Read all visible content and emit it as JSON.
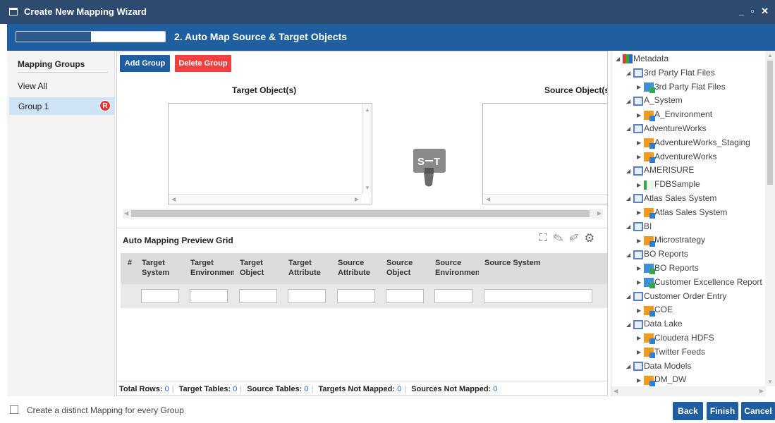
{
  "window": {
    "title": "Create New Mapping Wizard",
    "controls": "_ ▫ ✕"
  },
  "step": {
    "title": "2. Auto Map Source & Target Objects",
    "progress": 0.5
  },
  "sidebar": {
    "title": "Mapping Groups",
    "view_all": "View All",
    "groups": [
      {
        "label": "Group 1",
        "badge": "R"
      }
    ]
  },
  "toolbar": {
    "add_group": "Add Group",
    "delete_group": "Delete Group"
  },
  "objects": {
    "target_label": "Target Object(s)",
    "source_label": "Source Object(s"
  },
  "grid": {
    "title": "Auto Mapping Preview Grid",
    "columns": [
      "#",
      "Target System",
      "Target Environment",
      "Target Object",
      "Target Attribute",
      "Source Attribute",
      "Source Object",
      "Source Environment",
      "Source System"
    ],
    "footer": {
      "total_rows_label": "Total Rows:",
      "total_rows": "0",
      "target_tables_label": "Target Tables:",
      "target_tables": "0",
      "source_tables_label": "Source Tables:",
      "source_tables": "0",
      "targets_not_mapped_label": "Targets Not Mapped:",
      "targets_not_mapped": "0",
      "sources_not_mapped_label": "Sources Not Mapped:",
      "sources_not_mapped": "0"
    }
  },
  "tree": [
    {
      "label": "Metadata",
      "icon": "metadata-icon",
      "level": 0,
      "expanded": true
    },
    {
      "label": "3rd Party Flat Files",
      "icon": "system-icon",
      "level": 1,
      "expanded": true
    },
    {
      "label": "3rd Party Flat Files",
      "icon": "flat-file-icon",
      "level": 2,
      "expanded": false
    },
    {
      "label": "A_System",
      "icon": "system-icon",
      "level": 1,
      "expanded": true
    },
    {
      "label": "A_Environment",
      "icon": "environment-icon",
      "level": 2,
      "expanded": false
    },
    {
      "label": "AdventureWorks",
      "icon": "system-icon",
      "level": 1,
      "expanded": true
    },
    {
      "label": "AdventureWorks_Staging",
      "icon": "environment-icon",
      "level": 2,
      "expanded": false
    },
    {
      "label": "AdventureWorks",
      "icon": "environment-icon",
      "level": 2,
      "expanded": false
    },
    {
      "label": "AMERISURE",
      "icon": "system-icon",
      "level": 1,
      "expanded": true
    },
    {
      "label": "FDBSample",
      "icon": "excel-icon",
      "level": 2,
      "expanded": false
    },
    {
      "label": "Atlas Sales System",
      "icon": "system-icon",
      "level": 1,
      "expanded": true
    },
    {
      "label": "Atlas Sales System",
      "icon": "environment-icon",
      "level": 2,
      "expanded": false
    },
    {
      "label": "BI",
      "icon": "system-icon",
      "level": 1,
      "expanded": true
    },
    {
      "label": "Microstrategy",
      "icon": "environment-icon",
      "level": 2,
      "expanded": false
    },
    {
      "label": "BO Reports",
      "icon": "system-icon",
      "level": 1,
      "expanded": true
    },
    {
      "label": "BO Reports",
      "icon": "flat-file-icon",
      "level": 2,
      "expanded": false
    },
    {
      "label": "Customer Excellence Report",
      "icon": "flat-file-icon",
      "level": 2,
      "expanded": false
    },
    {
      "label": "Customer Order Entry",
      "icon": "system-icon",
      "level": 1,
      "expanded": true
    },
    {
      "label": "COE",
      "icon": "environment-icon",
      "level": 2,
      "expanded": false
    },
    {
      "label": "Data Lake",
      "icon": "system-icon",
      "level": 1,
      "expanded": true
    },
    {
      "label": "Cloudera HDFS",
      "icon": "environment-icon",
      "level": 2,
      "expanded": false
    },
    {
      "label": "Twitter Feeds",
      "icon": "environment-icon",
      "level": 2,
      "expanded": false
    },
    {
      "label": "Data Models",
      "icon": "system-icon",
      "level": 1,
      "expanded": true
    },
    {
      "label": "DM_DW",
      "icon": "environment-icon",
      "level": 2,
      "expanded": false
    }
  ],
  "bottom": {
    "checkbox_label": "Create a distinct Mapping for every Group",
    "checked": false,
    "back": "Back",
    "finish": "Finish",
    "cancel": "Cancel"
  },
  "colors": {
    "titlebar": "#2e4a6e",
    "accent": "#1f5fa0",
    "danger": "#f04040",
    "selected": "#cfe3f7",
    "link_value": "#1f6fc0"
  }
}
